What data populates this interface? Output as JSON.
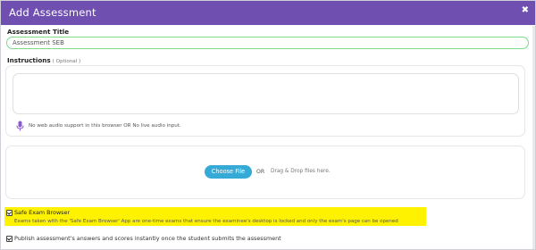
{
  "header": {
    "title": "Add Assessment",
    "close_icon": "close-icon"
  },
  "assessment_title": {
    "label": "Assessment Title",
    "value": "Assessment SEB"
  },
  "instructions": {
    "label": "Instructions",
    "optional": "( Optional )",
    "value": "",
    "audio_note": "No web audio support in this browser OR No live audio input.",
    "mic_icon": "microphone-icon"
  },
  "upload": {
    "choose_file": "Choose File",
    "or": "OR",
    "drag_drop": "Drag & Drop files here."
  },
  "safe_exam_browser": {
    "checked": true,
    "label": "Safe Exam Browser",
    "description": "Exams taken with the 'Safe Exam Browser' App are one-time exams that ensure the examinee's desktop is locked and only the exam's page can be opened"
  },
  "publish": {
    "checked": true,
    "label": "Publish assessment's answers and scores instantly once the student submits the assessment"
  },
  "colors": {
    "header": "#6f4fb0",
    "choose_button": "#36aad7",
    "highlight": "#fff200",
    "input_border": "#7cdc8a",
    "mic": "#8a5ad6"
  }
}
